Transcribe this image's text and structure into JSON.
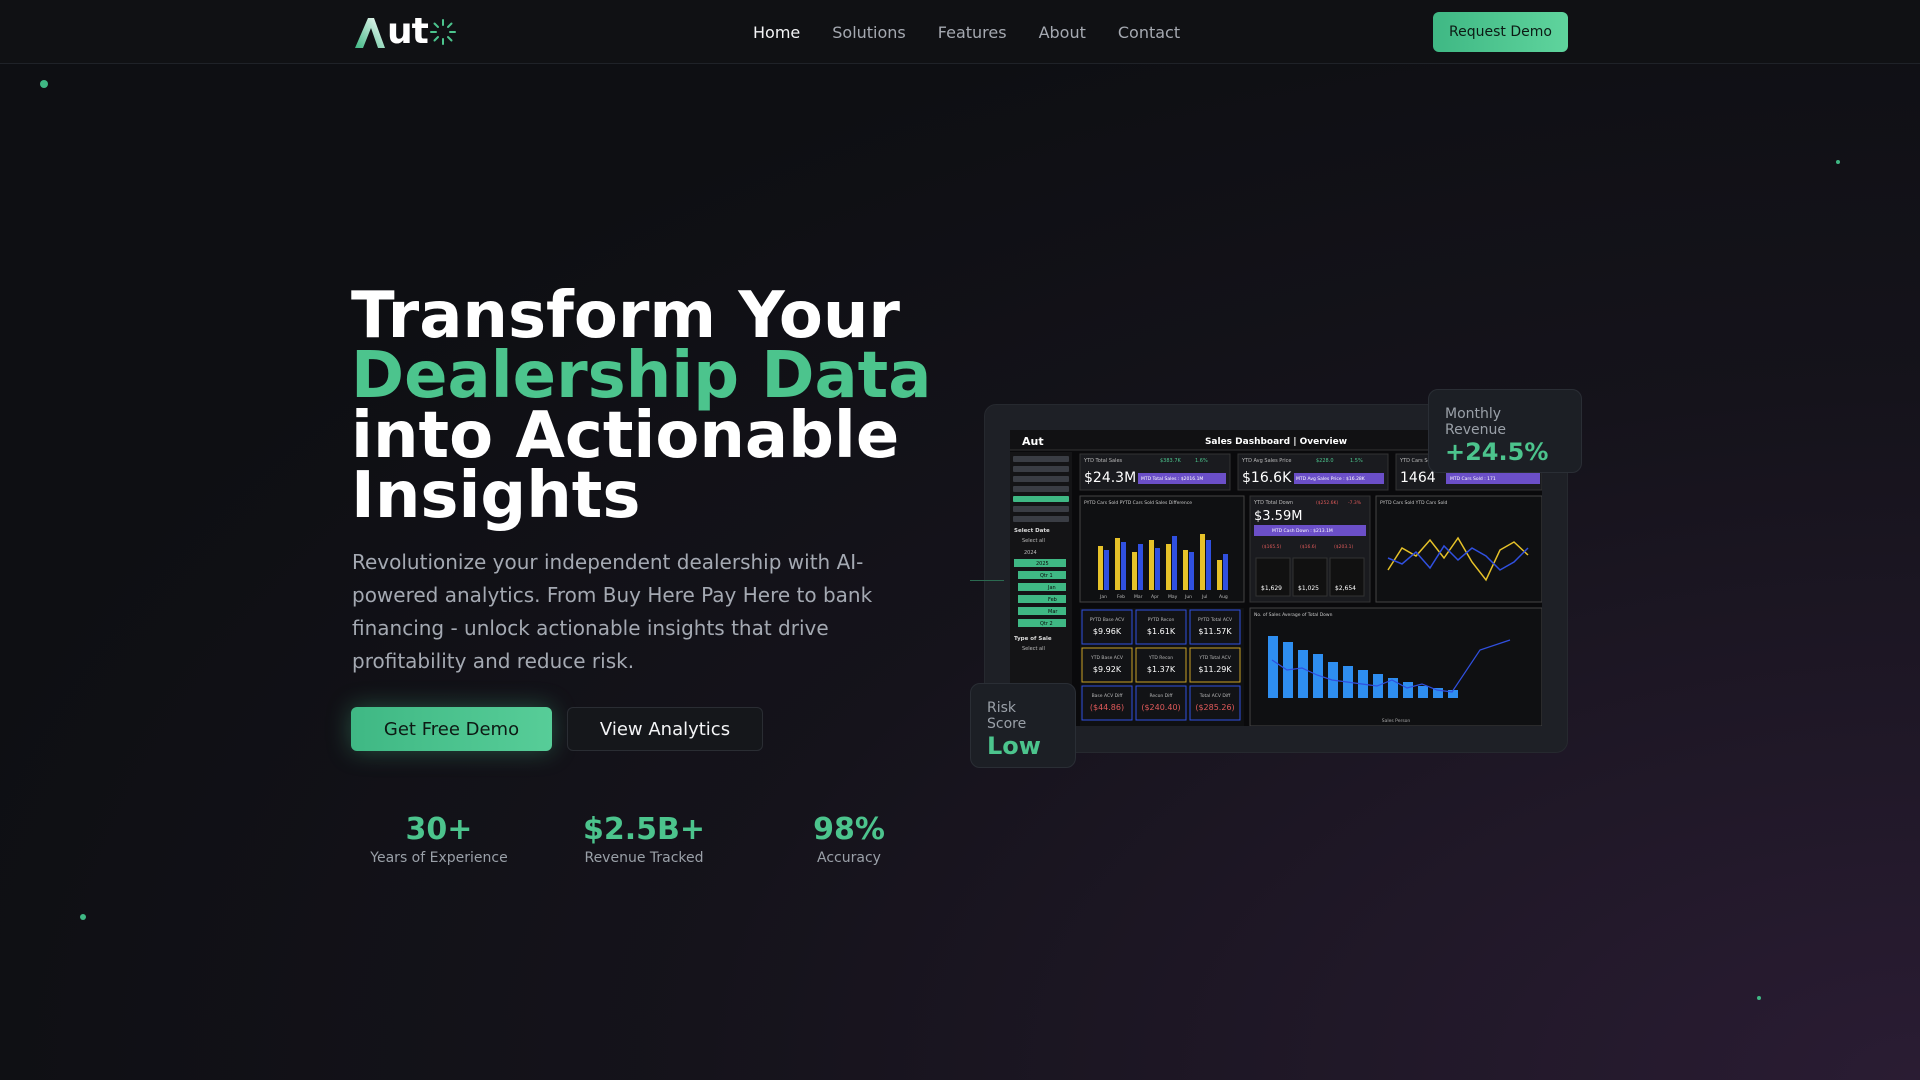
{
  "brand": {
    "logo_text": "ut",
    "logo_letter": "A",
    "accent": "#4cc48d"
  },
  "nav": {
    "links": [
      "Home",
      "Solutions",
      "Features",
      "About",
      "Contact"
    ],
    "cta": "Request Demo"
  },
  "hero": {
    "title_line1": "Transform Your",
    "title_line2": "Dealership Data",
    "title_line3": "into Actionable",
    "title_line4": "Insights",
    "subtitle": "Revolutionize your independent dealership with AI-powered analytics. From Buy Here Pay Here to bank financing - unlock actionable insights that drive profitability and reduce risk.",
    "primary_button": "Get Free Demo",
    "secondary_button": "View Analytics"
  },
  "stats": [
    {
      "value": "30+",
      "label": "Years of Experience"
    },
    {
      "value": "$2.5B+",
      "label": "Revenue Tracked"
    },
    {
      "value": "98%",
      "label": "Accuracy"
    }
  ],
  "dashboard": {
    "title": "Sales Dashboard | Overview",
    "logo": "Aut",
    "kpis": [
      {
        "label": "YTD Total Sales",
        "value": "$24.3M",
        "badge": "MTD Total Sales : $2016.1M",
        "delta1": "$383.7K",
        "delta2": "1.6%"
      },
      {
        "label": "YTD Avg Sales Price",
        "value": "$16.6K",
        "badge": "MTD Avg Sales Price : $16.28K",
        "delta1": "$228.0",
        "delta2": "1.5%"
      },
      {
        "label": "YTD Cars Sold",
        "value": "1464",
        "badge": "MTD Cars Sold : 171"
      }
    ],
    "down_card": {
      "label": "YTD Total Down",
      "value": "$3.59M",
      "badge": "MTD Cash Down : $213.1M",
      "neg1": "($165.5)",
      "neg2": "($16.6)",
      "neg3": "($203.1)",
      "delta_neg": "($252.6K)",
      "delta_pct": "-7.3%",
      "sub": [
        {
          "l": "YTD Avg Down",
          "v": "$1,629"
        },
        {
          "l": "YTD Avg Deferred",
          "v": "$1,025"
        },
        {
          "l": "YTD Avg Cash Down",
          "v": "$2,654"
        }
      ]
    },
    "acv_cards": [
      {
        "label": "PYTD Base ACV",
        "value": "$9.96K"
      },
      {
        "label": "PYTD Recon",
        "value": "$1.61K"
      },
      {
        "label": "PYTD Total ACV",
        "value": "$11.57K"
      },
      {
        "label": "YTD Base ACV",
        "value": "$9.92K"
      },
      {
        "label": "YTD Recon",
        "value": "$1.37K"
      },
      {
        "label": "YTD Total ACV",
        "value": "$11.29K"
      },
      {
        "label": "Base ACV Diff",
        "value": "($44.86)"
      },
      {
        "label": "Recon Diff",
        "value": "($240.40)"
      },
      {
        "label": "Total ACV Diff",
        "value": "($285.26)"
      }
    ],
    "filter": {
      "heading": "Select Date",
      "select_all": "Select all",
      "years": [
        "2024",
        "2025"
      ],
      "quarter": "Qtr 1",
      "months": [
        "Jan",
        "Feb",
        "Mar"
      ],
      "qtr2": "Qtr 2",
      "type_heading": "Type of Sale",
      "type_select_all": "Select all"
    },
    "months_axis": [
      "Jan",
      "Feb",
      "Mar",
      "Apr",
      "May",
      "Jun",
      "Jul",
      "Aug"
    ],
    "bar_legend": "PYTD Cars Sold  PYTD Cars Sold  Sales Difference",
    "line_legend": "PYTD Cars Sold  YTD Cars Sold",
    "bottom_legend": "No. of Sales  Average of Total Down",
    "bottom_xlabel": "Sales Person"
  },
  "floating_cards": {
    "revenue": {
      "label": "Monthly Revenue",
      "value": "+24.5%"
    },
    "risk": {
      "label": "Risk Score",
      "value": "Low"
    }
  }
}
